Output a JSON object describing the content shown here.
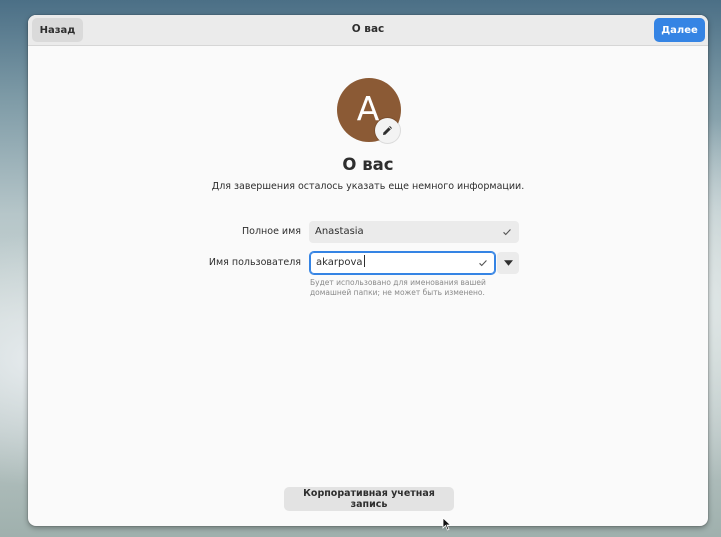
{
  "header": {
    "back_label": "Назад",
    "title": "О вас",
    "next_label": "Далее"
  },
  "avatar": {
    "initial": "A",
    "edit_icon": "pencil-icon",
    "color": "#8b5a35"
  },
  "main": {
    "heading": "О вас",
    "subtitle": "Для завершения осталось указать еще немного информации."
  },
  "form": {
    "full_name": {
      "label": "Полное имя",
      "value": "Anastasia",
      "status_icon": "checkmark-icon"
    },
    "username": {
      "label": "Имя пользователя",
      "value": "akarpova",
      "status_icon": "checkmark-icon",
      "dropdown_icon": "triangle-down-icon",
      "hint": "Будет использовано для именования вашей домашней папки; не может быть изменено."
    }
  },
  "footer": {
    "enterprise_label": "Корпоративная учетная запись"
  },
  "colors": {
    "accent": "#3584e4",
    "window_bg": "#fafafa"
  }
}
